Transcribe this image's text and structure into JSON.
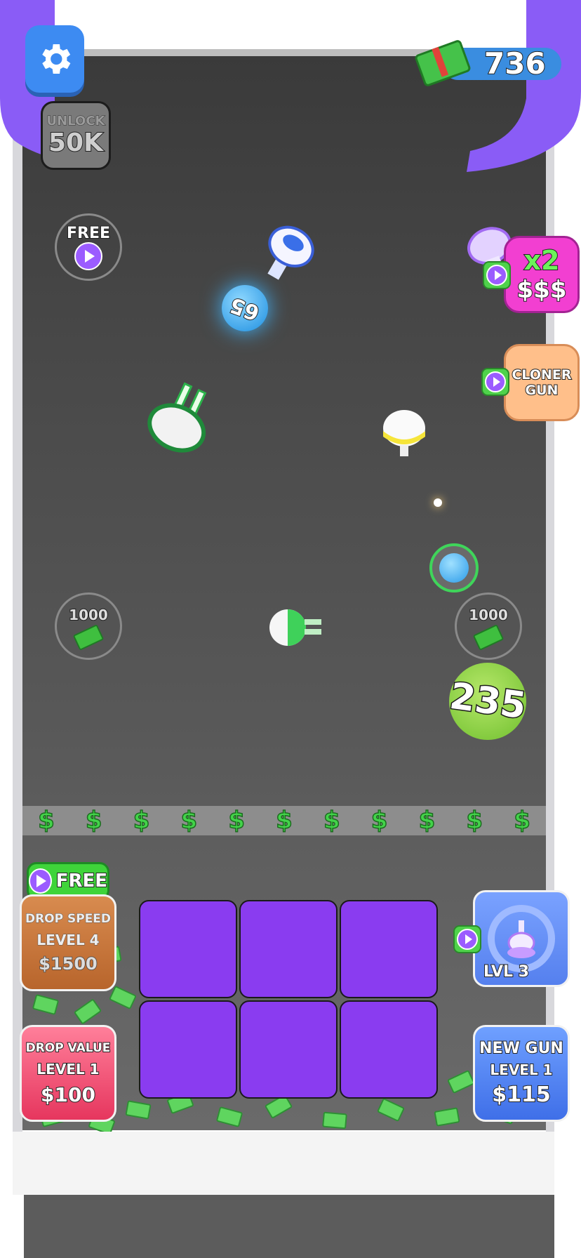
{
  "colors": {
    "purple_tube": "#8a5cf6",
    "grid_cell": "#8a3cf0",
    "arena_bg": "#404040",
    "dollar_green": "#43d34a",
    "settings_blue": "#3d8bf2"
  },
  "top": {
    "settings_icon": "gear-icon",
    "cash_amount": "736",
    "unlock_label": "UNLOCK",
    "unlock_value": "50K"
  },
  "arena": {
    "free_label": "FREE",
    "ball_blue_value": "65",
    "ball_green_value": "235",
    "reward_left_value": "1000",
    "reward_right_value": "1000",
    "x2_label": "x2",
    "x2_sub": "$$$",
    "cloner_line1": "CLONER",
    "cloner_line2": "GUN",
    "dollar_strip": [
      "$",
      "$",
      "$",
      "$",
      "$",
      "$",
      "$",
      "$",
      "$",
      "$",
      "$"
    ]
  },
  "bottom": {
    "free_button_label": "FREE",
    "drop_speed": {
      "title": "DROP SPEED",
      "level": "LEVEL 4",
      "price": "$1500"
    },
    "drop_value": {
      "title": "DROP VALUE",
      "level": "LEVEL 1",
      "price": "$100"
    },
    "gun_slot": {
      "level": "LVL 3"
    },
    "new_gun": {
      "title": "NEW GUN",
      "level": "LEVEL 1",
      "price": "$115"
    }
  }
}
